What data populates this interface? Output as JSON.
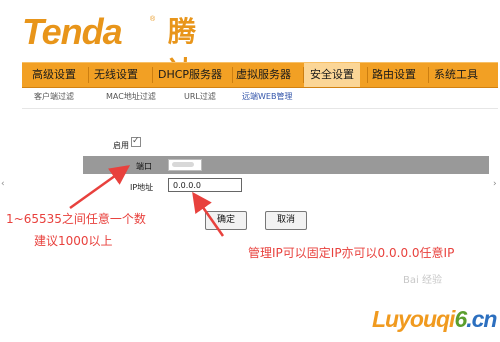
{
  "logo": {
    "latin": "Tenda",
    "reg": "®",
    "chinese": "腾达"
  },
  "nav": {
    "items": [
      "高级设置",
      "无线设置",
      "DHCP服务器",
      "虚拟服务器",
      "安全设置",
      "路由设置",
      "系统工具"
    ],
    "active": "安全设置"
  },
  "subnav": {
    "items": [
      "客户端过滤",
      "MAC地址过滤",
      "URL过滤",
      "远端WEB管理"
    ],
    "active": "远端WEB管理"
  },
  "form": {
    "enable_label": "启用",
    "enable_checked": true,
    "port_label": "端口",
    "ip_label": "IP地址",
    "ip_value": "0.0.0.0",
    "ok_label": "确定",
    "cancel_label": "取消"
  },
  "annotations": {
    "port_note_line1": "1~65535之间任意一个数",
    "port_note_line2": "建议1000以上",
    "ip_note": "管理IP可以固定IP亦可以0.0.0.0任意IP"
  },
  "side_arrows": {
    "left": "‹",
    "right": "›"
  },
  "watermark": {
    "top": "Bai 经验",
    "main_1": "Luyouqi",
    "main_2": "6",
    "main_3": ".cn"
  },
  "colors": {
    "accent": "#f2a024",
    "annotation": "#e8413d",
    "brand": "#e8951a"
  }
}
